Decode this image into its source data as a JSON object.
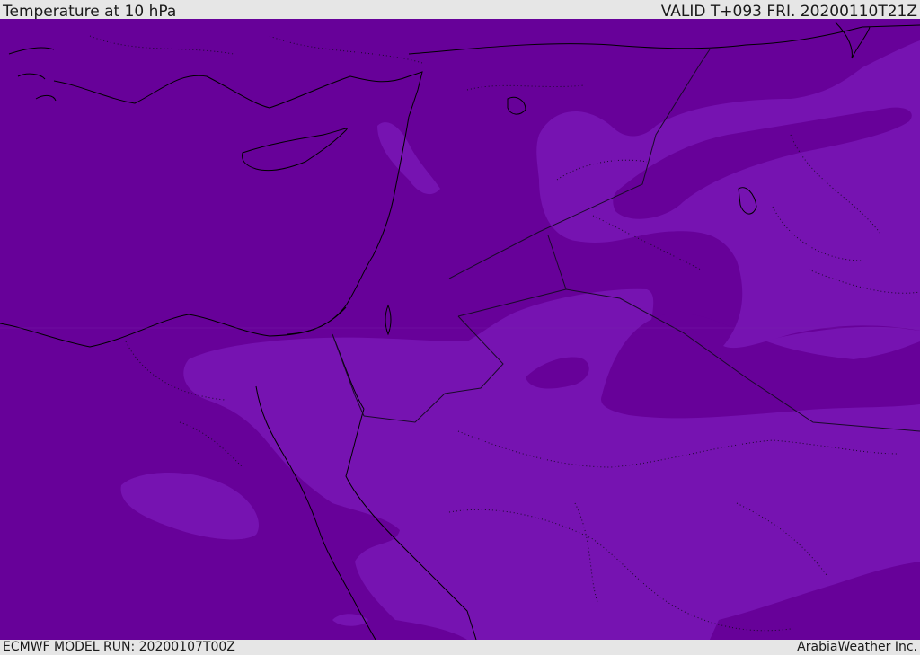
{
  "header": {
    "title": "Temperature at 10 hPa",
    "valid": "VALID T+093 FRI. 20200110T21Z"
  },
  "footer": {
    "model_run": "ECMWF MODEL RUN: 20200107T00Z",
    "credit": "ArabiaWeather Inc."
  },
  "colors": {
    "band_cold": "#670199",
    "band_warm": "#7613b1",
    "coast_line": "#000000",
    "border_line": "#1a0a2a",
    "frame": "#e6e6e6"
  },
  "map": {
    "variable": "Temperature at 10 hPa",
    "region": "Middle East",
    "legend_visible": false
  }
}
